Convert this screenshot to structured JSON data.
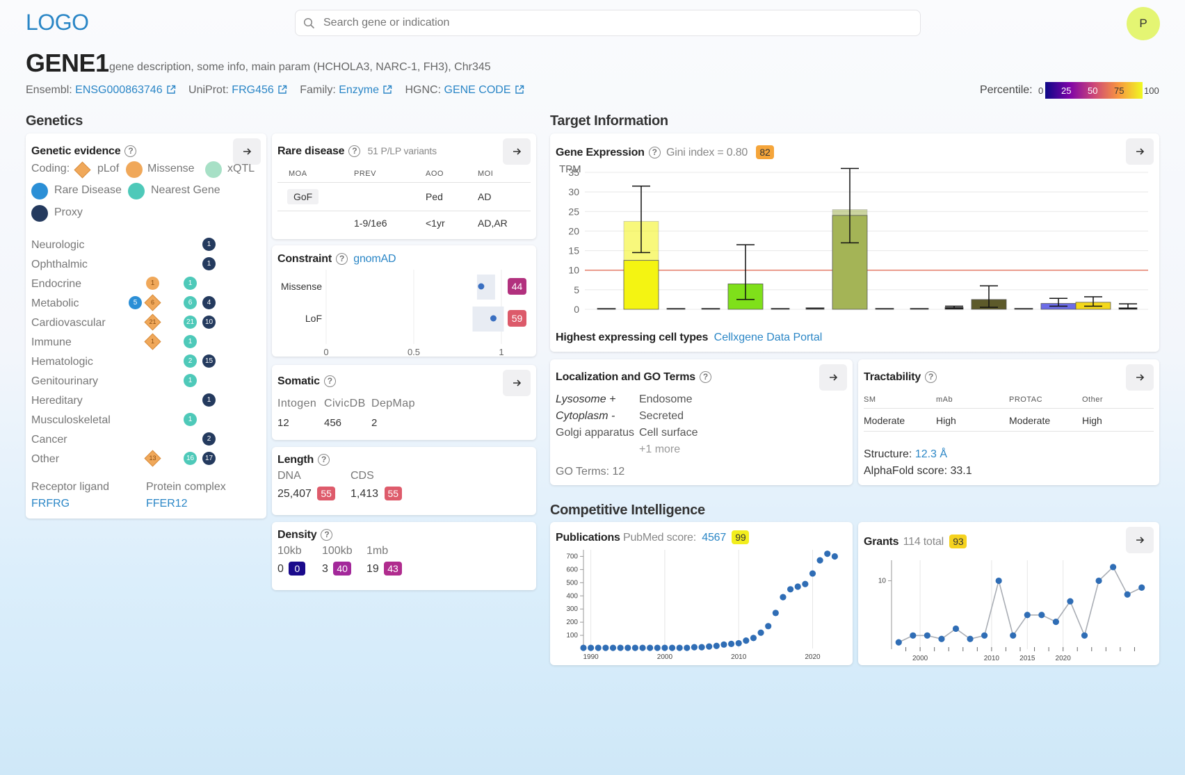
{
  "header": {
    "logo": "LOGO",
    "search_placeholder": "Search gene or indication",
    "avatar_letter": "P",
    "avatar_color": "#e4f573"
  },
  "gene": {
    "name": "GENE1",
    "description": "gene description, some info, main param (HCHOLA3, NARC-1, FH3), Chr345",
    "ensembl_label": "Ensembl:",
    "ensembl_value": "ENSG000863746",
    "uniprot_label": "UniProt:",
    "uniprot_value": "FRG456",
    "family_label": "Family:",
    "family_value": "Enzyme",
    "hgnc_label": "HGNC:",
    "hgnc_value": "GENE CODE"
  },
  "percentile": {
    "label": "Percentile:",
    "ticks": [
      "0",
      "25",
      "50",
      "75",
      "100"
    ]
  },
  "sections": {
    "genetics": "Genetics",
    "target_information": "Target Information",
    "competitive_intelligence": "Competitive Intelligence"
  },
  "genetic_evidence": {
    "title": "Genetic evidence",
    "coding_label": "Coding:",
    "legend": [
      "pLof",
      "Missense",
      "xQTL",
      "Rare Disease",
      "Nearest Gene",
      "Proxy"
    ],
    "colors": {
      "plof": "#f0a85a",
      "missense": "#f0a85a",
      "xqtl": "#a7e0c6",
      "rare": "#2b8fd6",
      "nearest": "#4ec9b9",
      "proxy": "#243a5e"
    },
    "rows": [
      {
        "name": "Neurologic",
        "proxy": "1"
      },
      {
        "name": "Ophthalmic",
        "proxy": "1"
      },
      {
        "name": "Endocrine",
        "missense": "1",
        "nearest": "1"
      },
      {
        "name": "Metabolic",
        "rare": "5",
        "plof": "6",
        "nearest": "6",
        "proxy": "4"
      },
      {
        "name": "Cardiovascular",
        "plof": "21",
        "nearest": "21",
        "proxy": "10"
      },
      {
        "name": "Immune",
        "plof": "1",
        "nearest": "1"
      },
      {
        "name": "Hematologic",
        "nearest": "2",
        "proxy": "15"
      },
      {
        "name": "Genitourinary",
        "nearest": "1"
      },
      {
        "name": "Hereditary",
        "proxy": "1"
      },
      {
        "name": "Musculoskeletal",
        "nearest": "1"
      },
      {
        "name": "Cancer",
        "proxy": "2"
      },
      {
        "name": "Other",
        "plof": "13",
        "nearest": "16",
        "proxy": "17"
      }
    ],
    "receptor_label": "Receptor ligand",
    "receptor_value": "FRFRG",
    "complex_label": "Protein complex",
    "complex_value": "FFER12"
  },
  "rare_disease": {
    "title": "Rare disease",
    "subtitle": "51 P/LP variants",
    "headers": [
      "MOA",
      "PREV",
      "AOO",
      "MOI"
    ],
    "rows": [
      [
        "GoF",
        "",
        "Ped",
        "AD"
      ],
      [
        "",
        "1-9/1e6",
        "<1yr",
        "AD,AR"
      ]
    ]
  },
  "constraint": {
    "title": "Constraint",
    "source": "gnomAD",
    "rows": [
      {
        "label": "Missense",
        "value": 0.94,
        "badge": "44",
        "color": "#b2317e"
      },
      {
        "label": "LoF",
        "value": 0.99,
        "badge": "59",
        "color": "#dc5a6a"
      }
    ],
    "axis": [
      "0",
      "0.5",
      "1"
    ]
  },
  "somatic": {
    "title": "Somatic",
    "cols": [
      {
        "label": "Intogen",
        "value": "12"
      },
      {
        "label": "CivicDB",
        "value": "456"
      },
      {
        "label": "DepMap",
        "value": "2"
      }
    ]
  },
  "length": {
    "title": "Length",
    "dna_label": "DNA",
    "dna_value": "25,407",
    "dna_badge": "55",
    "cds_label": "CDS",
    "cds_value": "1,413",
    "cds_badge": "55"
  },
  "density": {
    "title": "Density",
    "cols": [
      {
        "label": "10kb",
        "value": "0",
        "badge": "0",
        "color": "#1a0a8c"
      },
      {
        "label": "100kb",
        "value": "3",
        "badge": "40",
        "color": "#a3289a"
      },
      {
        "label": "1mb",
        "value": "19",
        "badge": "43",
        "color": "#b02c8e"
      }
    ]
  },
  "gene_expression": {
    "title": "Gene Expression",
    "gini": "Gini index = 0.80",
    "badge": "82",
    "cell_types_label": "Highest expressing cell types",
    "cell_types_link": "Cellxgene Data Portal"
  },
  "localization": {
    "title": "Localization and GO Terms",
    "left": [
      "Lysosome +",
      "Cytoplasm -",
      "Golgi apparatus"
    ],
    "right": [
      "Endosome",
      "Secreted",
      "Cell surface"
    ],
    "more": "+1 more",
    "go_terms": "GO Terms: 12"
  },
  "tractability": {
    "title": "Tractability",
    "headers": [
      "SM",
      "mAb",
      "PROTAC",
      "Other"
    ],
    "values": [
      "Moderate",
      "High",
      "Moderate",
      "High"
    ],
    "structure_label": "Structure:",
    "structure_value": "12.3 Å",
    "alphafold": "AlphaFold score: 33.1"
  },
  "publications": {
    "title": "Publications",
    "score_label": "PubMed score:",
    "score_value": "4567",
    "badge": "99"
  },
  "grants": {
    "title": "Grants",
    "total": "114 total",
    "badge": "93"
  },
  "chart_data": [
    {
      "type": "bar",
      "ylabel": "TPM",
      "ylim": [
        0,
        35
      ],
      "yticks": [
        "0",
        "5",
        "10",
        "15",
        "20",
        "25",
        "30",
        "35"
      ],
      "threshold": 10,
      "grid": true,
      "bars": [
        {
          "value": 0.2,
          "color": "#222222"
        },
        {
          "value": 12.5,
          "upper": 22.5,
          "err_low": 14.5,
          "err_high": 31.5,
          "color": "#f4f412"
        },
        {
          "value": 0.2,
          "color": "#222222"
        },
        {
          "value": 0.1,
          "color": "#222222"
        },
        {
          "value": 6.5,
          "err_low": 2.5,
          "err_high": 16.5,
          "color": "#7fe01a"
        },
        {
          "value": 0.2,
          "color": "#222222"
        },
        {
          "value": 0.4,
          "color": "#222222"
        },
        {
          "value": 24.0,
          "upper": 25.5,
          "err_low": 17.0,
          "err_high": 36.0,
          "color": "#a4b456"
        },
        {
          "value": 0.2,
          "color": "#222222"
        },
        {
          "value": 0.2,
          "color": "#222222"
        },
        {
          "value": 0.5,
          "err_low": 0.3,
          "err_high": 0.8,
          "color": "#222222"
        },
        {
          "value": 2.5,
          "err_low": 0.5,
          "err_high": 6.0,
          "color": "#5d5a2a"
        },
        {
          "value": 0.2,
          "color": "#222222"
        },
        {
          "value": 1.5,
          "err_low": 0.8,
          "err_high": 2.8,
          "color": "#6c6ce6"
        },
        {
          "value": 1.8,
          "err_low": 0.8,
          "err_high": 3.2,
          "color": "#f4d81a"
        },
        {
          "value": 0.4,
          "err_low": 0.2,
          "err_high": 1.4,
          "color": "#222222"
        }
      ]
    },
    {
      "type": "scatter",
      "title": "Publications",
      "x": [
        1989,
        1990,
        1991,
        1992,
        1993,
        1994,
        1995,
        1996,
        1997,
        1998,
        1999,
        2000,
        2001,
        2002,
        2003,
        2004,
        2005,
        2006,
        2007,
        2008,
        2009,
        2010,
        2011,
        2012,
        2013,
        2014,
        2015,
        2016,
        2017,
        2018,
        2019,
        2020,
        2021,
        2022,
        2023
      ],
      "y": [
        5,
        5,
        5,
        5,
        5,
        5,
        5,
        5,
        5,
        5,
        5,
        5,
        5,
        5,
        5,
        10,
        10,
        15,
        20,
        30,
        35,
        40,
        60,
        80,
        120,
        170,
        270,
        390,
        450,
        470,
        490,
        570,
        670,
        720,
        700
      ],
      "xlim": [
        1989,
        2024
      ],
      "ylim": [
        0,
        750
      ],
      "xticks": [
        "1990",
        "2000",
        "2010",
        "2020"
      ],
      "yticks": [
        "100",
        "200",
        "300",
        "400",
        "500",
        "600",
        "700"
      ]
    },
    {
      "type": "line",
      "title": "Grants",
      "x": [
        1997,
        1999,
        2001,
        2003,
        2005,
        2007,
        2009,
        2011,
        2013,
        2015,
        2017,
        2019,
        2021,
        2023,
        2025,
        2027,
        2029,
        2031
      ],
      "y": [
        1,
        2,
        2,
        1.5,
        3,
        1.5,
        2,
        10,
        2,
        5,
        5,
        4,
        7,
        2,
        10,
        12,
        8,
        9
      ],
      "xlim": [
        1996,
        2032
      ],
      "ylim": [
        0,
        13
      ],
      "xticks": [
        "2000",
        "2010",
        "2015",
        "2020"
      ],
      "yticks": [
        "10"
      ]
    }
  ]
}
